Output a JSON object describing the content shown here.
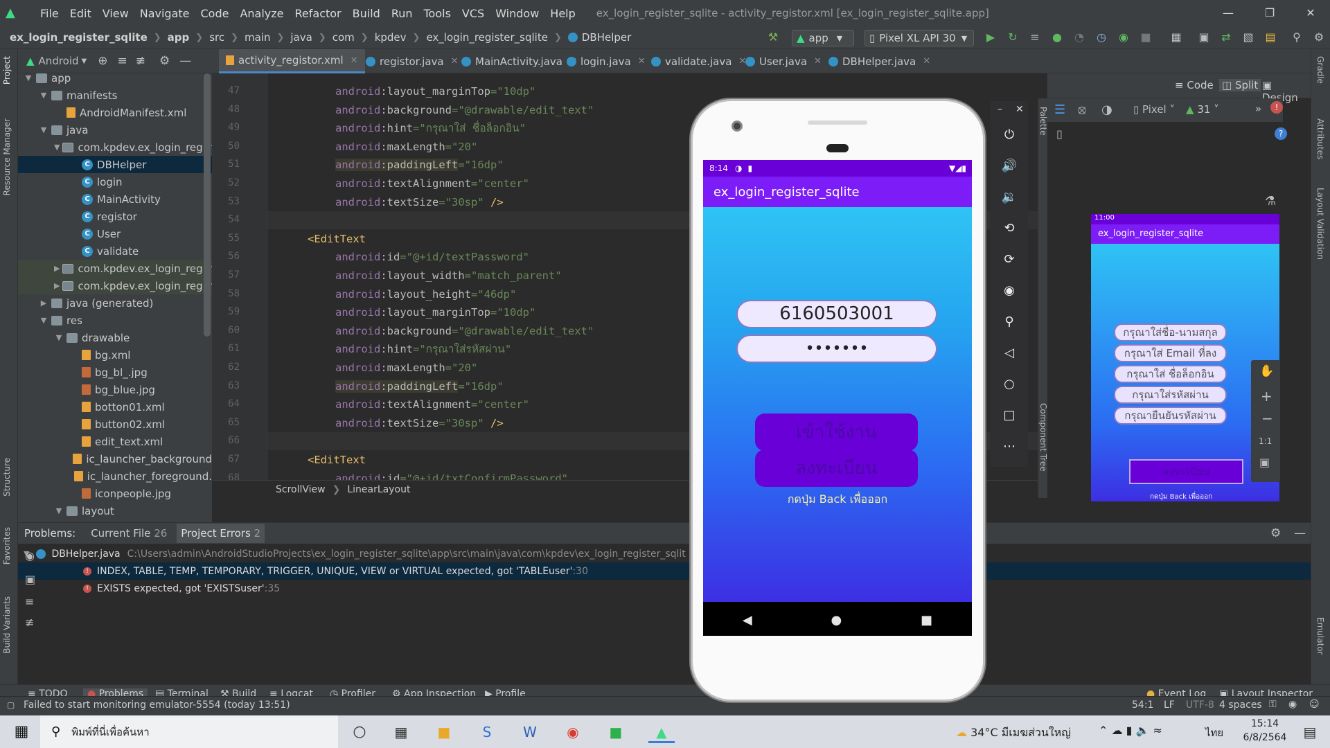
{
  "window_title": "ex_login_register_sqlite - activity_registor.xml [ex_login_register_sqlite.app]",
  "menu": [
    "File",
    "Edit",
    "View",
    "Navigate",
    "Code",
    "Analyze",
    "Refactor",
    "Build",
    "Run",
    "Tools",
    "VCS",
    "Window",
    "Help"
  ],
  "breadcrumbs": [
    "ex_login_register_sqlite",
    "app",
    "src",
    "main",
    "java",
    "com",
    "kpdev",
    "ex_login_register_sqlite",
    "DBHelper"
  ],
  "toolbar": {
    "run_config": "app",
    "device": "Pixel XL API 30"
  },
  "project": {
    "view_label": "Android"
  },
  "tree": [
    {
      "label": "app",
      "depth": 0,
      "type": "folder",
      "arrow": "▼"
    },
    {
      "label": "manifests",
      "depth": 1,
      "type": "folder",
      "arrow": "▼"
    },
    {
      "label": "AndroidManifest.xml",
      "depth": 2,
      "type": "xml",
      "arrow": ""
    },
    {
      "label": "java",
      "depth": 1,
      "type": "folder",
      "arrow": "▼"
    },
    {
      "label": "com.kpdev.ex_login_registe",
      "depth": 2,
      "type": "pkg",
      "arrow": "▼"
    },
    {
      "label": "DBHelper",
      "depth": 3,
      "type": "cls",
      "arrow": "",
      "selected": true
    },
    {
      "label": "login",
      "depth": 3,
      "type": "cls",
      "arrow": ""
    },
    {
      "label": "MainActivity",
      "depth": 3,
      "type": "cls",
      "arrow": ""
    },
    {
      "label": "registor",
      "depth": 3,
      "type": "cls",
      "arrow": ""
    },
    {
      "label": "User",
      "depth": 3,
      "type": "cls",
      "arrow": ""
    },
    {
      "label": "validate",
      "depth": 3,
      "type": "cls",
      "arrow": ""
    },
    {
      "label": "com.kpdev.ex_login_registe",
      "depth": 2,
      "type": "pkg",
      "arrow": "▶"
    },
    {
      "label": "com.kpdev.ex_login_registe",
      "depth": 2,
      "type": "pkg",
      "arrow": "▶"
    },
    {
      "label": "java (generated)",
      "depth": 1,
      "type": "folder",
      "arrow": "▶"
    },
    {
      "label": "res",
      "depth": 1,
      "type": "folder",
      "arrow": "▼"
    },
    {
      "label": "drawable",
      "depth": 2,
      "type": "folder",
      "arrow": "▼"
    },
    {
      "label": "bg.xml",
      "depth": 3,
      "type": "xml",
      "arrow": ""
    },
    {
      "label": "bg_bl_.jpg",
      "depth": 3,
      "type": "img",
      "arrow": ""
    },
    {
      "label": "bg_blue.jpg",
      "depth": 3,
      "type": "img",
      "arrow": ""
    },
    {
      "label": "botton01.xml",
      "depth": 3,
      "type": "xml",
      "arrow": ""
    },
    {
      "label": "button02.xml",
      "depth": 3,
      "type": "xml",
      "arrow": ""
    },
    {
      "label": "edit_text.xml",
      "depth": 3,
      "type": "xml",
      "arrow": ""
    },
    {
      "label": "ic_launcher_background",
      "depth": 3,
      "type": "xml",
      "arrow": ""
    },
    {
      "label": "ic_launcher_foreground.",
      "depth": 3,
      "type": "xml",
      "arrow": ""
    },
    {
      "label": "iconpeople.jpg",
      "depth": 3,
      "type": "img",
      "arrow": ""
    },
    {
      "label": "layout",
      "depth": 2,
      "type": "folder",
      "arrow": "▼"
    }
  ],
  "editor_tabs": [
    {
      "label": "activity_registor.xml",
      "kind": "xml",
      "active": true
    },
    {
      "label": "registor.java",
      "kind": "java"
    },
    {
      "label": "MainActivity.java",
      "kind": "java"
    },
    {
      "label": "login.java",
      "kind": "java"
    },
    {
      "label": "validate.java",
      "kind": "java"
    },
    {
      "label": "User.java",
      "kind": "java"
    },
    {
      "label": "DBHelper.java",
      "kind": "java"
    }
  ],
  "code_lines": [
    {
      "n": "47",
      "indent": 2,
      "attr": "layout_marginTop",
      "val": "10dp"
    },
    {
      "n": "48",
      "indent": 2,
      "attr": "background",
      "val": "@drawable/edit_text"
    },
    {
      "n": "49",
      "indent": 2,
      "attr": "hint",
      "val": "กรุณาใส่ ชื่อล็อกอิน"
    },
    {
      "n": "50",
      "indent": 2,
      "attr": "maxLength",
      "val": "20"
    },
    {
      "n": "51",
      "indent": 2,
      "attr": "paddingLeft",
      "val": "16dp",
      "hl": true
    },
    {
      "n": "52",
      "indent": 2,
      "attr": "textAlignment",
      "val": "center"
    },
    {
      "n": "53",
      "indent": 2,
      "attr": "textSize",
      "val": "30sp",
      "close": " />"
    },
    {
      "n": "54",
      "blank": true
    },
    {
      "n": "55",
      "indent": 1,
      "tag": "<EditText"
    },
    {
      "n": "56",
      "indent": 2,
      "attr": "id",
      "val": "@+id/textPassword"
    },
    {
      "n": "57",
      "indent": 2,
      "attr": "layout_width",
      "val": "match_parent"
    },
    {
      "n": "58",
      "indent": 2,
      "attr": "layout_height",
      "val": "46dp"
    },
    {
      "n": "59",
      "indent": 2,
      "attr": "layout_marginTop",
      "val": "10dp"
    },
    {
      "n": "60",
      "indent": 2,
      "attr": "background",
      "val": "@drawable/edit_text"
    },
    {
      "n": "61",
      "indent": 2,
      "attr": "hint",
      "val": "กรุณาใส่รหัสผ่าน"
    },
    {
      "n": "62",
      "indent": 2,
      "attr": "maxLength",
      "val": "20"
    },
    {
      "n": "63",
      "indent": 2,
      "attr": "paddingLeft",
      "val": "16dp",
      "hl": true
    },
    {
      "n": "64",
      "indent": 2,
      "attr": "textAlignment",
      "val": "center"
    },
    {
      "n": "65",
      "indent": 2,
      "attr": "textSize",
      "val": "30sp",
      "close": " />"
    },
    {
      "n": "66",
      "blank": true
    },
    {
      "n": "67",
      "indent": 1,
      "tag": "<EditText"
    },
    {
      "n": "68",
      "indent": 2,
      "attr": "id",
      "val": "@+id/txtConfirmPassword"
    }
  ],
  "editor_breadcrumb": [
    "ScrollView",
    "LinearLayout"
  ],
  "design": {
    "code": "Code",
    "split": "Split",
    "design": "Design",
    "device": "Pixel",
    "api": "31"
  },
  "emulator": {
    "time": "8:14",
    "app_title": "ex_login_register_sqlite",
    "username_value": "6160503001",
    "password_value": "•••••••",
    "login_button": "เข้าใช้งาน",
    "register_button": "ลงทะเบียน",
    "back_hint": "กดปุ่ม Back เพื่อออก"
  },
  "preview": {
    "time": "11:00",
    "app_title": "ex_login_register_sqlite",
    "fields": [
      "กรุณาใส่ชื่อ-นามสกุล",
      "กรุณาใส่ Email ที่ลง",
      "กรุณาใส่ ชื่อล็อกอิน",
      "กรุณาใส่รหัสผ่าน",
      "กรุณายืนยันรหัสผ่าน"
    ],
    "button": "ลงทะเบียน",
    "back_hint": "กดปุ่ม Back เพื่อออก"
  },
  "problems": {
    "label": "Problems:",
    "tab_current": "Current File",
    "current_count": "26",
    "tab_project": "Project Errors",
    "project_count": "2",
    "file": "DBHelper.java",
    "path": "C:\\Users\\admin\\AndroidStudioProjects\\ex_login_register_sqlite\\app\\src\\main\\java\\com\\kpdev\\ex_login_register_sqlit",
    "errors": [
      {
        "msg": "INDEX, TABLE, TEMP, TEMPORARY, TRIGGER, UNIQUE, VIEW or VIRTUAL expected, got 'TABLEuser'",
        "loc": ":30"
      },
      {
        "msg": "EXISTS expected, got 'EXISTSuser'",
        "loc": ":35"
      }
    ]
  },
  "bottom_tabs": [
    "TODO",
    "Problems",
    "Terminal",
    "Build",
    "Logcat",
    "Profiler",
    "App Inspection",
    "Profile"
  ],
  "bottom_right": [
    "Event Log",
    "Layout Inspector"
  ],
  "status_msg": "Failed to start monitoring emulator-5554 (today 13:51)",
  "status_right": {
    "pos": "54:1",
    "sep": "LF",
    "enc": "UTF-8",
    "indent": "4 spaces"
  },
  "taskbar": {
    "search_placeholder": "พิมพ์ที่นี่เพื่อค้นหา",
    "weather": "34°C  มีเมฆส่วนใหญ่",
    "lang": "ไทย",
    "time": "15:14",
    "date": "6/8/2564"
  },
  "side_tabs": {
    "left": [
      "Project",
      "Resource Manager",
      "Structure",
      "Favorites",
      "Build Variants"
    ],
    "right": [
      "Gradle",
      "Attributes",
      "Layout Validation",
      "Emulator"
    ]
  }
}
